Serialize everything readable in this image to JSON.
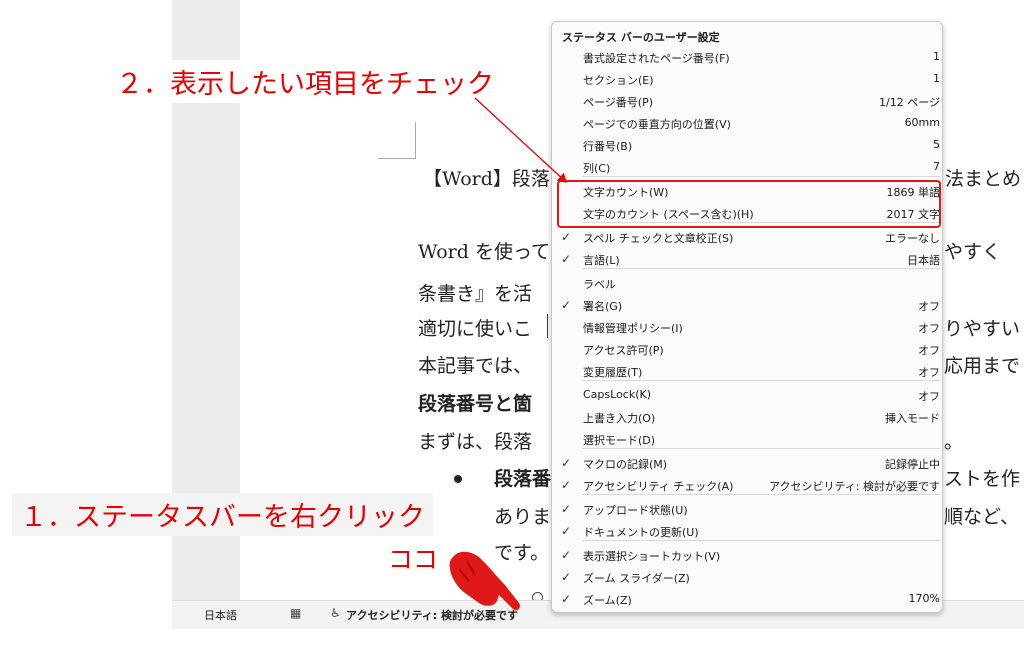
{
  "document": {
    "title_line": "【Word】段落",
    "title_tail": "法まとめ",
    "lines": [
      {
        "left": "Word を使って",
        "right": "やすく"
      },
      {
        "left": "条書き』を活",
        "right": ""
      },
      {
        "left": "適切に使いこ",
        "right": "りやすい"
      },
      {
        "left": "本記事では、",
        "right": "応用まで"
      },
      {
        "left": "段落番号と箇",
        "right": ""
      },
      {
        "left": "まずは、段落",
        "right": "。"
      },
      {
        "left": "段落番",
        "right": "ストを作"
      },
      {
        "left": "ありま",
        "right": "順など、"
      },
      {
        "left": "です。",
        "right": ""
      }
    ]
  },
  "status_bar": {
    "language": "日本語",
    "accessibility": "アクセシビリティ: 検討が必要です"
  },
  "menu": {
    "title": "ステータス バーのユーザー設定",
    "items": [
      {
        "label": "書式設定されたページ番号(F)",
        "value": "1",
        "checked": false
      },
      {
        "label": "セクション(E)",
        "value": "1",
        "checked": false
      },
      {
        "label": "ページ番号(P)",
        "value": "1/12 ページ",
        "checked": false
      },
      {
        "label": "ページでの垂直方向の位置(V)",
        "value": "60mm",
        "checked": false
      },
      {
        "label": "行番号(B)",
        "value": "5",
        "checked": false
      },
      {
        "label": "列(C)",
        "value": "7",
        "checked": false
      },
      {
        "label": "文字カウント(W)",
        "value": "1869 単語",
        "checked": false
      },
      {
        "label": "文字のカウント (スペース含む)(H)",
        "value": "2017 文字",
        "checked": false
      },
      {
        "label": "スペル チェックと文章校正(S)",
        "value": "エラーなし",
        "checked": true
      },
      {
        "label": "言語(L)",
        "value": "日本語",
        "checked": true
      },
      {
        "label": "ラベル",
        "value": "",
        "checked": false
      },
      {
        "label": "署名(G)",
        "value": "オフ",
        "checked": true
      },
      {
        "label": "情報管理ポリシー(I)",
        "value": "オフ",
        "checked": false
      },
      {
        "label": "アクセス許可(P)",
        "value": "オフ",
        "checked": false
      },
      {
        "label": "変更履歴(T)",
        "value": "オフ",
        "checked": false
      },
      {
        "label": "CapsLock(K)",
        "value": "オフ",
        "checked": false
      },
      {
        "label": "上書き入力(O)",
        "value": "挿入モード",
        "checked": false
      },
      {
        "label": "選択モード(D)",
        "value": "",
        "checked": false
      },
      {
        "label": "マクロの記録(M)",
        "value": "記録停止中",
        "checked": true
      },
      {
        "label": "アクセシビリティ チェック(A)",
        "value": "アクセシビリティ: 検討が必要です",
        "checked": true
      },
      {
        "label": "アップロード状態(U)",
        "value": "",
        "checked": true
      },
      {
        "label": "ドキュメントの更新(U)",
        "value": "",
        "checked": true
      },
      {
        "label": "表示選択ショートカット(V)",
        "value": "",
        "checked": true
      },
      {
        "label": "ズーム スライダー(Z)",
        "value": "",
        "checked": true
      },
      {
        "label": "ズーム(Z)",
        "value": "170%",
        "checked": true
      }
    ]
  },
  "annotations": {
    "step2": "２．表示したい項目をチェック",
    "step1": "１．ステータスバーを右クリック",
    "here": "ココ"
  },
  "colors": {
    "annotation": "#e60000",
    "highlight": "#e01818"
  }
}
